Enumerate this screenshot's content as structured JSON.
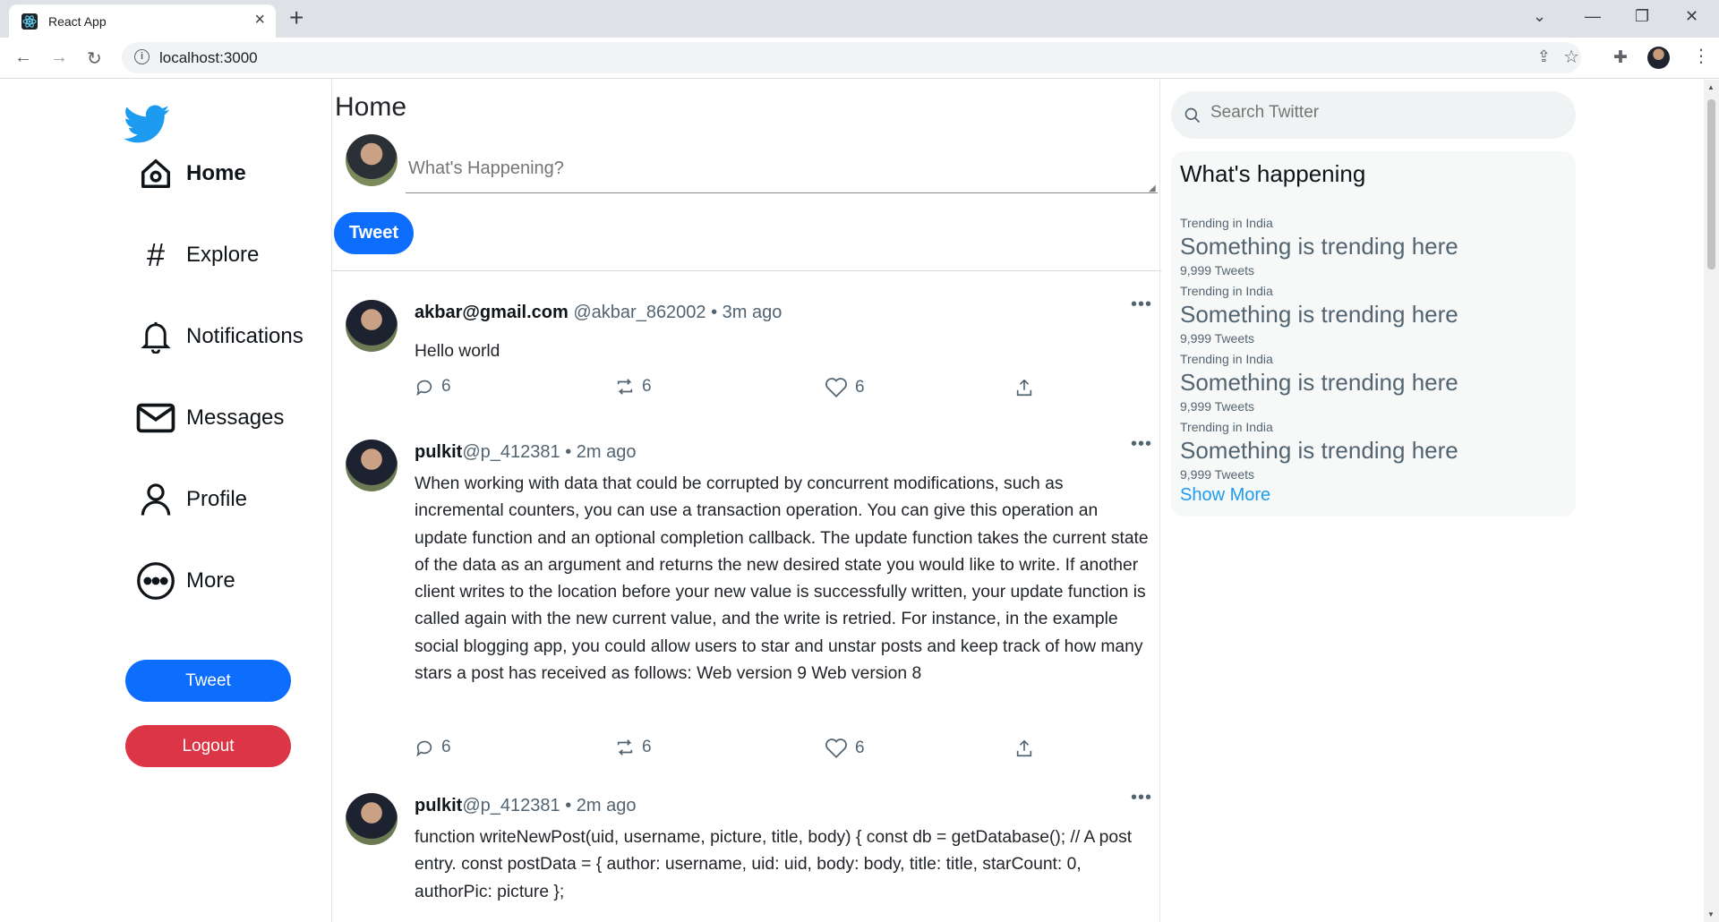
{
  "browser": {
    "tab_title": "React App",
    "url": "localhost:3000"
  },
  "sidebar": {
    "items": [
      {
        "label": "Home",
        "icon": "home-icon",
        "active": true
      },
      {
        "label": "Explore",
        "icon": "hash-icon"
      },
      {
        "label": "Notifications",
        "icon": "bell-icon"
      },
      {
        "label": "Messages",
        "icon": "mail-icon"
      },
      {
        "label": "Profile",
        "icon": "person-icon"
      },
      {
        "label": "More",
        "icon": "more-circle-icon"
      }
    ],
    "tweet_label": "Tweet",
    "logout_label": "Logout"
  },
  "feed": {
    "title": "Home",
    "composer_placeholder": "What's Happening?",
    "tweet_label": "Tweet",
    "posts": [
      {
        "name": "akbar@gmail.com",
        "handle": "@akbar_862002",
        "time": "• 3m ago",
        "text": "Hello world",
        "replies": "6",
        "retweets": "6",
        "likes": "6"
      },
      {
        "name": "pulkit",
        "handle": "@p_412381",
        "time": "• 2m ago",
        "text": "When working with data that could be corrupted by concurrent modifications, such as incremental counters, you can use a transaction operation. You can give this operation an update function and an optional completion callback. The update function takes the current state of the data as an argument and returns the new desired state you would like to write. If another client writes to the location before your new value is successfully written, your update function is called again with the new current value, and the write is retried. For instance, in the example social blogging app, you could allow users to star and unstar posts and keep track of how many stars a post has received as follows: Web version 9 Web version 8",
        "replies": "6",
        "retweets": "6",
        "likes": "6"
      },
      {
        "name": "pulkit",
        "handle": "@p_412381",
        "time": "• 2m ago",
        "text": "function writeNewPost(uid, username, picture, title, body) { const db = getDatabase(); // A post entry. const postData = { author: username, uid: uid, body: body, title: title, starCount: 0, authorPic: picture };"
      }
    ]
  },
  "right": {
    "search_placeholder": "Search Twitter",
    "trends_title": "What's happening",
    "trends": [
      {
        "meta": "Trending in India",
        "name": "Something is trending here",
        "count": "9,999 Tweets"
      },
      {
        "meta": "Trending in India",
        "name": "Something is trending here",
        "count": "9,999 Tweets"
      },
      {
        "meta": "Trending in India",
        "name": "Something is trending here",
        "count": "9,999 Tweets"
      },
      {
        "meta": "Trending in India",
        "name": "Something is trending here",
        "count": "9,999 Tweets"
      }
    ],
    "show_more": "Show More"
  },
  "colors": {
    "brand": "#1d9bf0",
    "primary_button": "#0d6efd",
    "danger_button": "#dc3545"
  }
}
